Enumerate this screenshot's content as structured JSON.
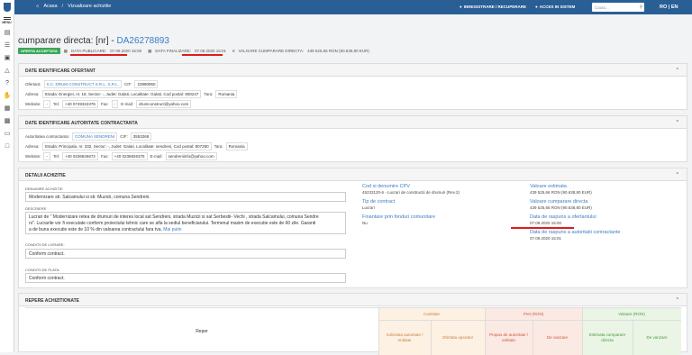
{
  "header": {
    "breadcrumb": [
      "Acasa",
      "Vizualizare achizitie"
    ],
    "links": [
      "INREGISTRARE / RECUPERARE",
      "ACCES IN SISTEM"
    ],
    "search_placeholder": "Cauta...",
    "lang": "RO | EN"
  },
  "sidebar": {
    "menu_label": "MENU"
  },
  "procurement": {
    "title_prefix": "cumparare directa: [nr] -",
    "id": "DA26278893",
    "status": "OFERTA ACCEPTATA",
    "published_label": "DATA PUBLICARE:",
    "published_value": "07.09.2020 15:00",
    "finalized_label": "DATA FINALIZARE:",
    "finalized_value": "07.09.2020 15:01",
    "value_label": "VALOARE CUMPARARE DIRECTA:",
    "value_value": "439 525,66 RON (90.638,80 EUR)"
  },
  "offerer": {
    "heading": "DATE IDENTIFICARE OFERTANT",
    "labels": {
      "offerer": "Ofertant:",
      "cif": "CIF:",
      "address": "Adresa:",
      "country": "Tara:",
      "website": "Website:",
      "tel": "Tel:",
      "fax": "Fax:",
      "email": "E-mail:"
    },
    "name": "S.C. DRUM CONSTRUCT S.R.L. S.R.L.",
    "cif": "23980950",
    "address": "Strada: Energiei, nr. 18, Sector: -, Judet: Galati, Localitate: Galati, Cod postal: 800247",
    "country": "Romania",
    "website": "-",
    "tel": "+40 0749322376",
    "fax": "-",
    "email": "drumconstruct@yahoo.com"
  },
  "authority": {
    "heading": "DATE IDENTIFICARE AUTORITATE CONTRACTANTA",
    "labels": {
      "authority": "Autoritatea contractanta:",
      "cif": "CIF:",
      "address": "Adresa:",
      "country": "Tara:",
      "website": "Website:",
      "tel": "Tel:",
      "fax": "Fax:",
      "email": "E-mail:"
    },
    "name": "COMUNA SENDRENI",
    "cif": "3553268",
    "address": "Strada: Principala, nr. 332, Sector: -, Judet: Galati, Localitate: sendreni, Cod postal: 807290",
    "country": "Romania",
    "website": "-",
    "tel": "+40 0236826872",
    "fax": "+40 0236826375",
    "email": "sendreniinfo@yahoo.com"
  },
  "details": {
    "heading": "DETALII ACHIZITIE",
    "name_label": "DENUMIRE ACHIZITIE",
    "name_value": "Modernizare str. Salcamului si str. Muzicii, comuna Sendreni.",
    "desc_label": "DESCRIERE",
    "desc_line1": "Lucrari de \" Modernizare retea de drumuri de interes local sat Sendreni, strada Muzicii si sat Serbestii- Vechi , strada Salcamului, comuna Sendre",
    "desc_line2": "ni\". Lucrarile vor fi executate conform proiectului tehnic care se afla la sediul beneficiarului. Termenul maxim de executie este de 60 zile. Garanti",
    "desc_line3": "a de buna executie este de 10 % din valoarea contractului fara tva.",
    "read_more": "Mai putin",
    "delivery_label": "CONDITII DE LIVRARE:",
    "delivery_value": "Conform contract.",
    "payment_label": "CONDITII DE PLATA:",
    "payment_value": "Conform contract.",
    "cpv_label": "Cod si denumire CPV",
    "cpv_value": "45233120-6 - Lucrari de constructii de drumuri (Rev.2)",
    "contract_type_label": "Tip de contract",
    "contract_type_value": "Lucrari",
    "eu_funds_label": "Finantare prin fonduri comunitare",
    "eu_funds_value": "Nu",
    "estimated_label": "Valoare estimata",
    "estimated_value": "439 525,66 RON (90.638,80 EUR)",
    "direct_value_label": "Valoare cumparare directa",
    "direct_value_value": "439 525,66 RON (90.638,80 EUR)",
    "offer_reply_label": "Data de raspuns a ofertantului",
    "offer_reply_value": "07.09.2020 15:00",
    "authority_reply_label": "Data de raspuns a autoritatii contractante",
    "authority_reply_value": "07.09.2020 15:01"
  },
  "items": {
    "heading": "REPERE ACHIZITIONATE",
    "col_reper": "Reper",
    "group_quantity": "Cantitate",
    "group_price": "Pret (RON)",
    "group_value": "Valoare (RON)",
    "col_requested": "Solicitata autoritate / entitate",
    "col_offered": "Ofertata operator",
    "col_proposed": "Propus de autoritate / entitate",
    "col_sale_price": "De vanzare",
    "col_estimated": "Estimata cumparare directa",
    "col_sale_value": "De vanzare"
  },
  "colors": {
    "topbar": "#2a5f96",
    "link": "#3b7dc4",
    "badge": "#3aa657",
    "highlight": "#e21b1b",
    "quantity_bg": "#fdf1e4",
    "price_bg": "#fbe9e4",
    "value_bg": "#eaf5e6"
  }
}
